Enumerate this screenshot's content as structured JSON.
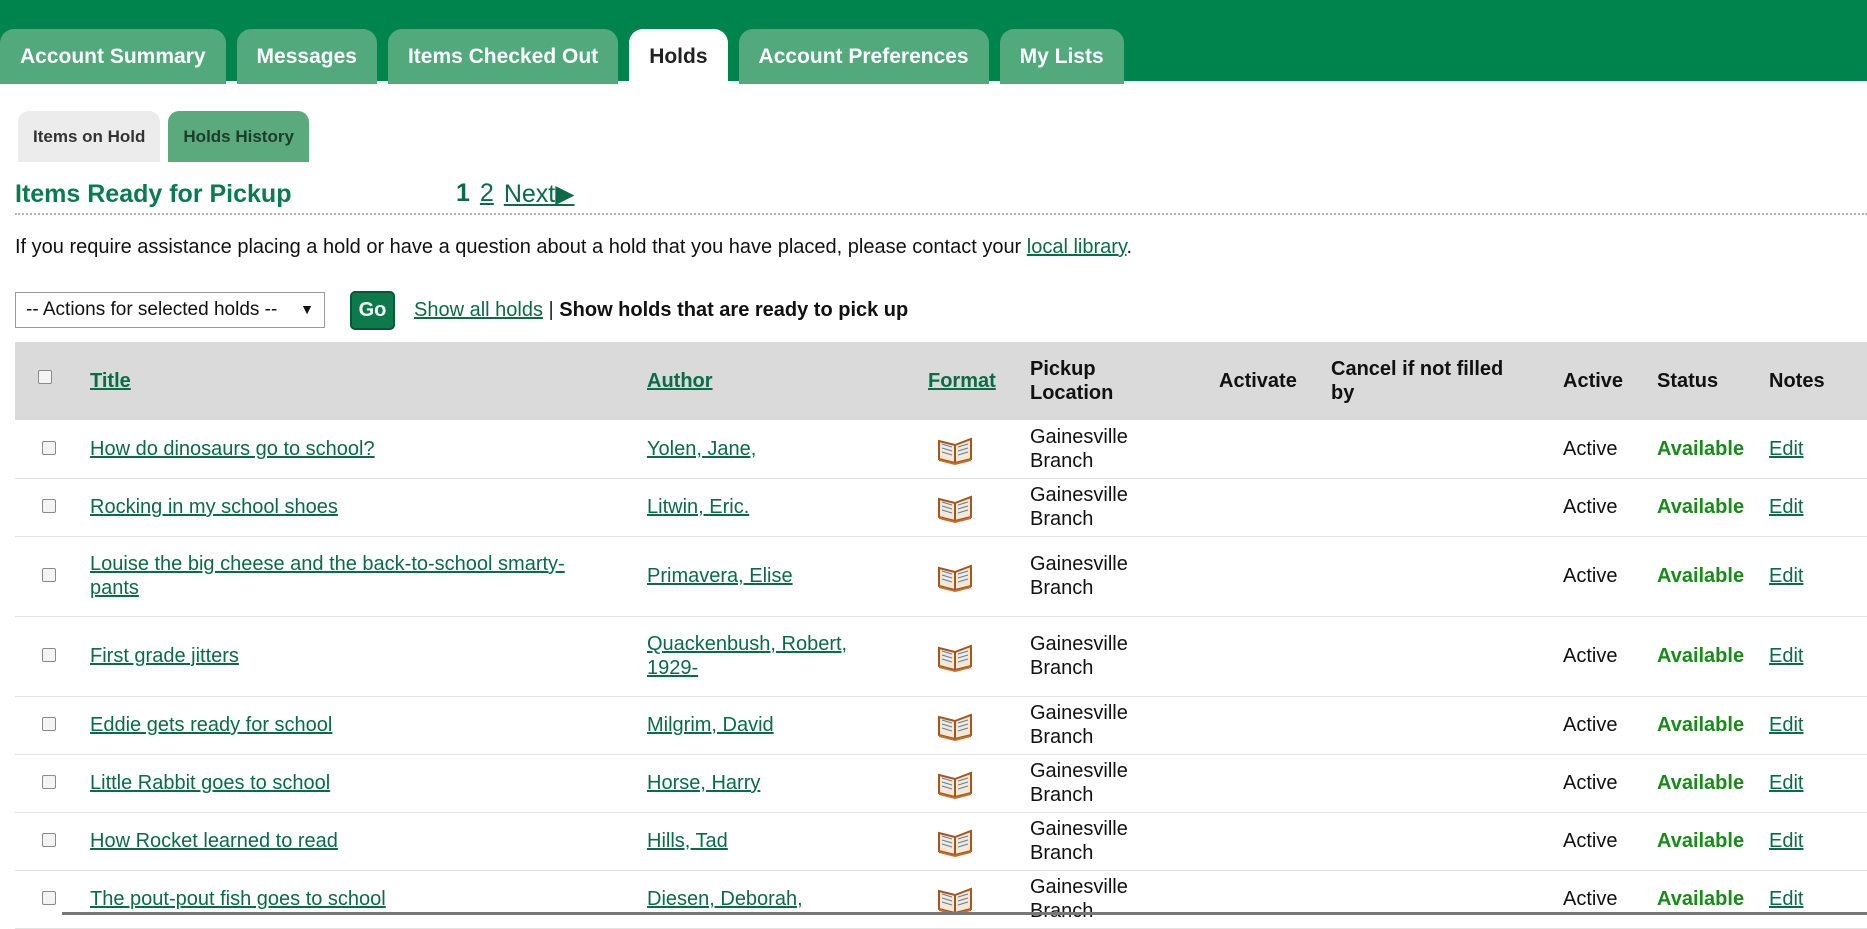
{
  "top_tabs": [
    {
      "label": "Account Summary",
      "active": false
    },
    {
      "label": "Messages",
      "active": false
    },
    {
      "label": "Items Checked Out",
      "active": false
    },
    {
      "label": "Holds",
      "active": true
    },
    {
      "label": "Account Preferences",
      "active": false
    },
    {
      "label": "My Lists",
      "active": false
    }
  ],
  "sub_tabs": [
    {
      "label": "Items on Hold"
    },
    {
      "label": "Holds History"
    }
  ],
  "heading": "Items Ready for Pickup",
  "pager": {
    "current": "1",
    "page2": "2",
    "next": "Next▶"
  },
  "assist": {
    "text": "If you require assistance placing a hold or have a question about a hold that you have placed, please contact your",
    "link": "local library",
    "suffix": "."
  },
  "actions": {
    "select_value": "-- Actions for selected holds --",
    "go": "Go"
  },
  "filter": {
    "show_all": "Show all holds",
    "separator": "|",
    "ready": "Show holds that are ready to pick up"
  },
  "table": {
    "headers": {
      "title": "Title",
      "author": "Author",
      "format": "Format",
      "pickup_line1": "Pickup",
      "pickup_line2": "Location",
      "activate": "Activate",
      "cancel_line1": "Cancel if not filled",
      "cancel_line2": "by",
      "active": "Active",
      "status": "Status",
      "notes": "Notes"
    },
    "rows": [
      {
        "title1": "How do dinosaurs go to school? ",
        "title2": "",
        "author1": "Yolen, Jane,",
        "author2": "",
        "pickup1": "Gainesville",
        "pickup2": "Branch",
        "active": "Active",
        "status": "Available",
        "notes": "Edit"
      },
      {
        "title1": "Rocking in my school shoes ",
        "title2": "",
        "author1": "Litwin, Eric.",
        "author2": "",
        "pickup1": "Gainesville",
        "pickup2": "Branch",
        "active": "Active",
        "status": "Available",
        "notes": "Edit"
      },
      {
        "title1": "Louise the big cheese and the back-to-school smarty-",
        "title2": "pants ",
        "author1": "Primavera, Elise",
        "author2": "",
        "pickup1": "Gainesville",
        "pickup2": "Branch",
        "active": "Active",
        "status": "Available",
        "notes": "Edit"
      },
      {
        "title1": "First grade jitters ",
        "title2": "",
        "author1": "Quackenbush, Robert,",
        "author2": "1929-",
        "pickup1": "Gainesville",
        "pickup2": "Branch",
        "active": "Active",
        "status": "Available",
        "notes": "Edit"
      },
      {
        "title1": "Eddie gets ready for school ",
        "title2": "",
        "author1": "Milgrim, David",
        "author2": "",
        "pickup1": "Gainesville",
        "pickup2": "Branch",
        "active": "Active",
        "status": "Available",
        "notes": "Edit"
      },
      {
        "title1": "Little Rabbit goes to school ",
        "title2": "",
        "author1": "Horse, Harry",
        "author2": "",
        "pickup1": "Gainesville",
        "pickup2": "Branch",
        "active": "Active",
        "status": "Available",
        "notes": "Edit"
      },
      {
        "title1": "How Rocket learned to read ",
        "title2": "",
        "author1": "Hills, Tad",
        "author2": "",
        "pickup1": "Gainesville",
        "pickup2": "Branch",
        "active": "Active",
        "status": "Available",
        "notes": "Edit"
      },
      {
        "title1": "The pout-pout fish goes to school ",
        "title2": "",
        "author1": "Diesen, Deborah,",
        "author2": "",
        "pickup1": "Gainesville",
        "pickup2": "Branch",
        "active": "Active",
        "status": "Available",
        "notes": "Edit"
      }
    ]
  },
  "colors": {
    "brand": "#00844e",
    "tab_inactive": "#52a97c",
    "link": "#0a6b46",
    "status": "#1a8a1a"
  }
}
